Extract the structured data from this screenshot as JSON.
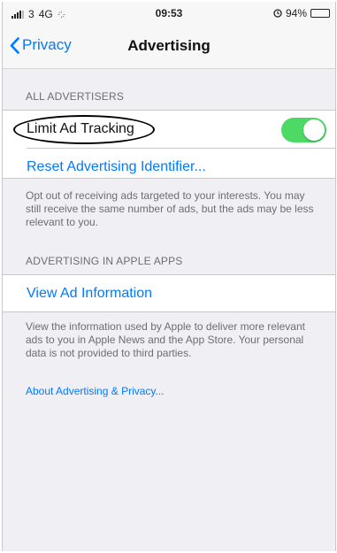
{
  "status_bar": {
    "carrier": "3",
    "network": "4G",
    "time": "09:53",
    "battery_percent": "94%",
    "battery_level": 0.94
  },
  "nav": {
    "back_label": "Privacy",
    "title": "Advertising"
  },
  "sections": {
    "all_advertisers": {
      "header": "ALL ADVERTISERS",
      "limit_ad_tracking_label": "Limit Ad Tracking",
      "limit_ad_tracking_on": true,
      "reset_label": "Reset Advertising Identifier...",
      "footer": "Opt out of receiving ads targeted to your interests. You may still receive the same number of ads, but the ads may be less relevant to you."
    },
    "apple_apps": {
      "header": "ADVERTISING IN APPLE APPS",
      "view_ad_info_label": "View Ad Information",
      "footer": "View the information used by Apple to deliver more relevant ads to you in Apple News and the App Store. Your personal data is not provided to third parties."
    }
  },
  "about_link": "About Advertising & Privacy...",
  "colors": {
    "accent": "#007aff",
    "toggle_on": "#4cd964",
    "background": "#efeff4"
  },
  "icons": [
    "signal-icon",
    "alarm-icon",
    "battery-icon",
    "chevron-left-icon"
  ]
}
